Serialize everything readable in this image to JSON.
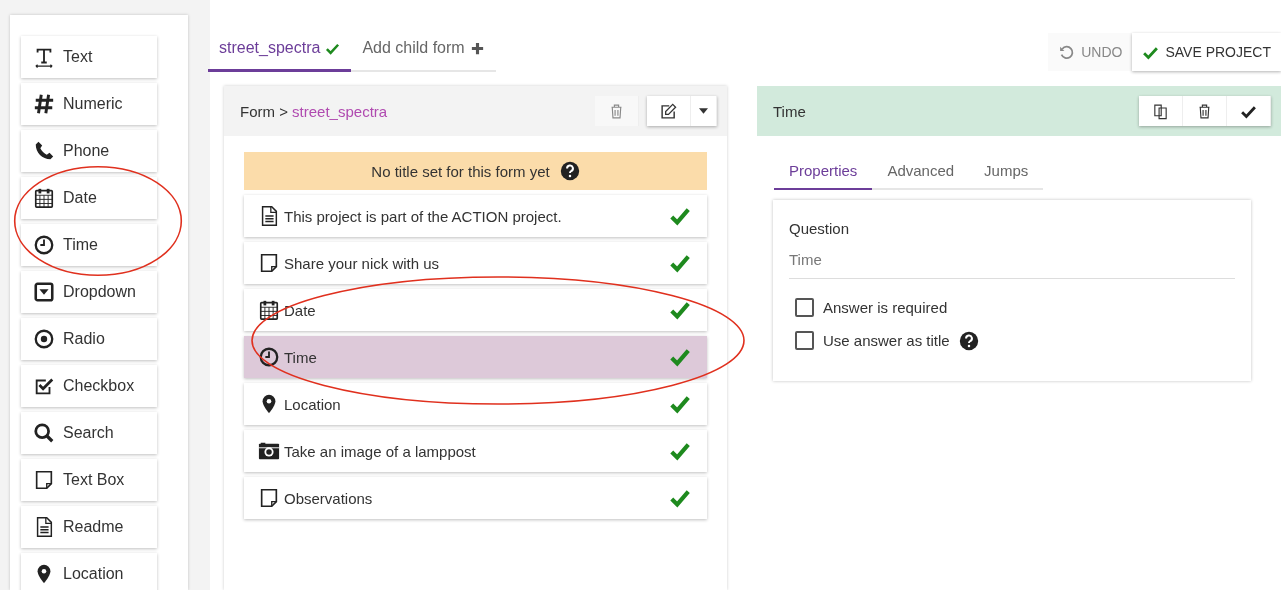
{
  "palette": [
    {
      "label": "Text",
      "kind": "text"
    },
    {
      "label": "Numeric",
      "kind": "numeric"
    },
    {
      "label": "Phone",
      "kind": "phone"
    },
    {
      "label": "Date",
      "kind": "date"
    },
    {
      "label": "Time",
      "kind": "time"
    },
    {
      "label": "Dropdown",
      "kind": "dropdown"
    },
    {
      "label": "Radio",
      "kind": "radio"
    },
    {
      "label": "Checkbox",
      "kind": "checkbox"
    },
    {
      "label": "Search",
      "kind": "search"
    },
    {
      "label": "Text Box",
      "kind": "textbox"
    },
    {
      "label": "Readme",
      "kind": "readme"
    },
    {
      "label": "Location",
      "kind": "location"
    }
  ],
  "tabs": [
    {
      "label": "street_spectra",
      "selected": true,
      "kind": "check"
    },
    {
      "label": "Add child form",
      "selected": false,
      "kind": "plus"
    }
  ],
  "toolbar": {
    "undo": "UNDO",
    "save": "SAVE PROJECT"
  },
  "form": {
    "prefix": "Form >",
    "name": "street_spectra",
    "notice": "No title set for this form yet",
    "questions": [
      {
        "label": "This project is part of the ACTION project.",
        "kind": "readme",
        "selected": false,
        "valid": true
      },
      {
        "label": "Share your nick with us",
        "kind": "textbox",
        "selected": false,
        "valid": true
      },
      {
        "label": "Date",
        "kind": "date",
        "selected": false,
        "valid": true
      },
      {
        "label": "Time",
        "kind": "time",
        "selected": true,
        "valid": true
      },
      {
        "label": "Location",
        "kind": "location",
        "selected": false,
        "valid": true
      },
      {
        "label": "Take an image of a lamppost",
        "kind": "camera",
        "selected": false,
        "valid": true
      },
      {
        "label": "Observations",
        "kind": "textbox",
        "selected": false,
        "valid": true
      }
    ]
  },
  "detail": {
    "title": "Time",
    "tabs": [
      {
        "label": "Properties",
        "selected": true
      },
      {
        "label": "Advanced",
        "selected": false
      },
      {
        "label": "Jumps",
        "selected": false
      }
    ],
    "question_label": "Question",
    "question_value": "Time",
    "options": [
      {
        "label": "Answer is required",
        "checked": false,
        "help": false
      },
      {
        "label": "Use answer as title",
        "checked": false,
        "help": true
      }
    ]
  },
  "annotations": [
    {
      "kind": "ellipse"
    },
    {
      "kind": "ellipse"
    }
  ]
}
